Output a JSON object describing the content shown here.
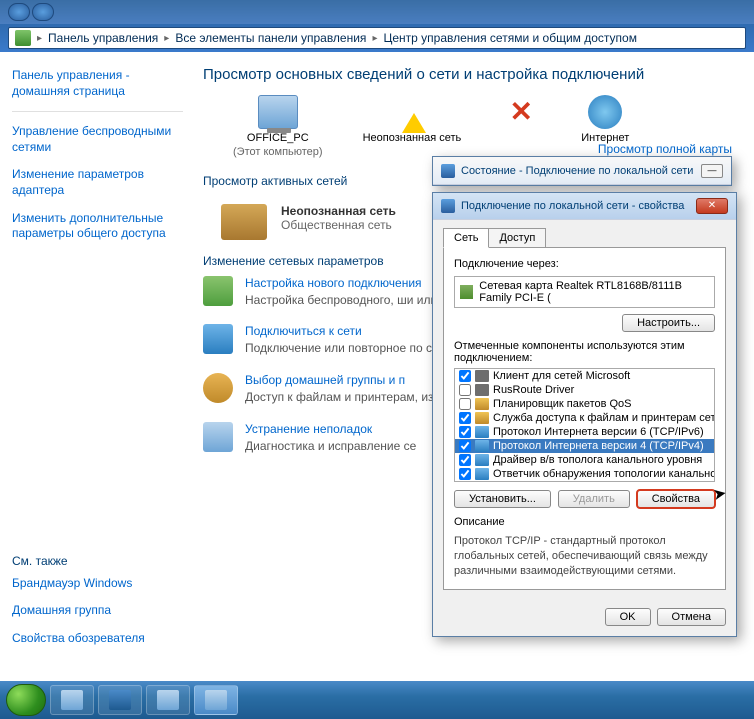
{
  "breadcrumb": {
    "a": "Панель управления",
    "b": "Все элементы панели управления",
    "c": "Центр управления сетями и общим доступом"
  },
  "sidebar": {
    "home": "Панель управления - домашняя страница",
    "links": [
      "Управление беспроводными сетями",
      "Изменение параметров адаптера",
      "Изменить дополнительные параметры общего доступа"
    ],
    "related_h": "См. также",
    "related": [
      "Брандмауэр Windows",
      "Домашняя группа",
      "Свойства обозревателя"
    ]
  },
  "main": {
    "h1": "Просмотр основных сведений о сети и настройка подключений",
    "map_link": "Просмотр полной карты",
    "nodes": {
      "pc": "OFFICE_PC",
      "pc_sub": "(Этот компьютер)",
      "unk": "Неопознанная сеть",
      "inet": "Интернет"
    },
    "h2a": "Просмотр активных сетей",
    "net": {
      "title": "Неопознанная сеть",
      "sub": "Общественная сеть"
    },
    "h2b": "Изменение сетевых параметров",
    "tasks": [
      {
        "t": "Настройка нового подключения",
        "d": "Настройка беспроводного, ши или же настройка маршрутиза"
      },
      {
        "t": "Подключиться к сети",
        "d": "Подключение или повторное по сетевому соединению или под"
      },
      {
        "t": "Выбор домашней группы и п",
        "d": "Доступ к файлам и принтерам, изменение параметров общего"
      },
      {
        "t": "Устранение неполадок",
        "d": "Диагностика и исправление се"
      }
    ]
  },
  "dlg_status": {
    "title": "Состояние - Подключение по локальной сети"
  },
  "dlg_props": {
    "title": "Подключение по локальной сети - свойства",
    "tab_net": "Сеть",
    "tab_access": "Доступ",
    "conn_via": "Подключение через:",
    "adapter": "Сетевая карта Realtek RTL8168B/8111B Family PCI-E (",
    "btn_cfg": "Настроить...",
    "comp_label": "Отмеченные компоненты используются этим подключением:",
    "components": [
      {
        "c": true,
        "n": "Клиент для сетей Microsoft",
        "k": "cli"
      },
      {
        "c": false,
        "n": "RusRoute Driver",
        "k": "cli"
      },
      {
        "c": false,
        "n": "Планировщик пакетов QoS",
        "k": "svc"
      },
      {
        "c": true,
        "n": "Служба доступа к файлам и принтерам сетей Micro...",
        "k": "svc"
      },
      {
        "c": true,
        "n": "Протокол Интернета версии 6 (TCP/IPv6)",
        "k": "proto"
      },
      {
        "c": true,
        "n": "Протокол Интернета версии 4 (TCP/IPv4)",
        "k": "proto",
        "sel": true
      },
      {
        "c": true,
        "n": "Драйвер в/в тополога канального уровня",
        "k": "proto"
      },
      {
        "c": true,
        "n": "Ответчик обнаружения топологии канального уровня",
        "k": "proto"
      }
    ],
    "btn_install": "Установить...",
    "btn_remove": "Удалить",
    "btn_props": "Свойства",
    "desc_h": "Описание",
    "desc": "Протокол TCP/IP - стандартный протокол глобальных сетей, обеспечивающий связь между различными взаимодействующими сетями.",
    "ok": "OK",
    "cancel": "Отмена"
  }
}
